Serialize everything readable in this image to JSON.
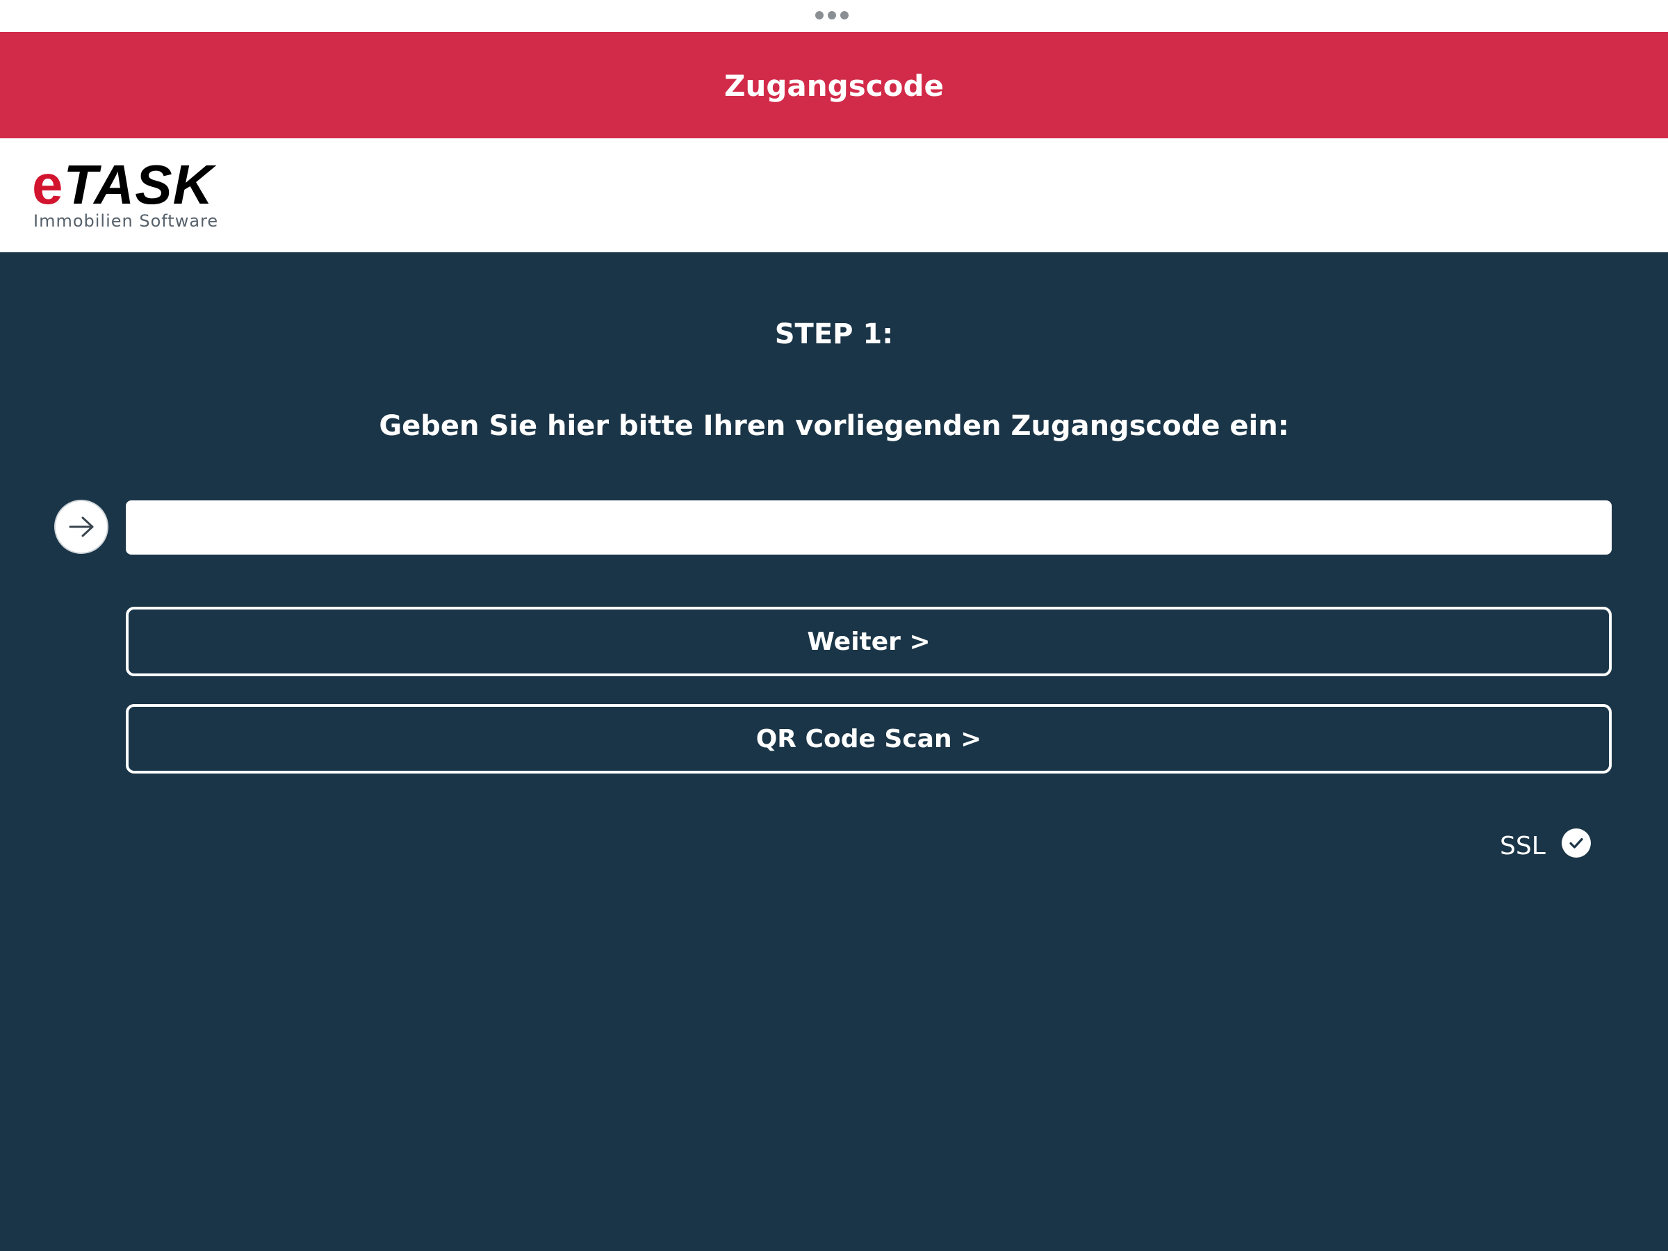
{
  "topbar": {
    "more_icon": "more-dots-icon"
  },
  "header": {
    "title": "Zugangscode",
    "color": "#d22b49"
  },
  "logo": {
    "prefix": "e",
    "word": "TASK",
    "tagline": "Immobilien  Software"
  },
  "main": {
    "background": "#1a3547",
    "step_label": "STEP 1:",
    "prompt": "Geben Sie hier bitte Ihren vorliegenden Zugangscode ein:",
    "code_input": {
      "value": "",
      "placeholder": ""
    },
    "submit_icon": "arrow-right-icon",
    "next_button": "Weiter >",
    "qr_button": "QR Code Scan >",
    "ssl_label": "SSL",
    "ssl_icon": "checkmark-icon"
  }
}
